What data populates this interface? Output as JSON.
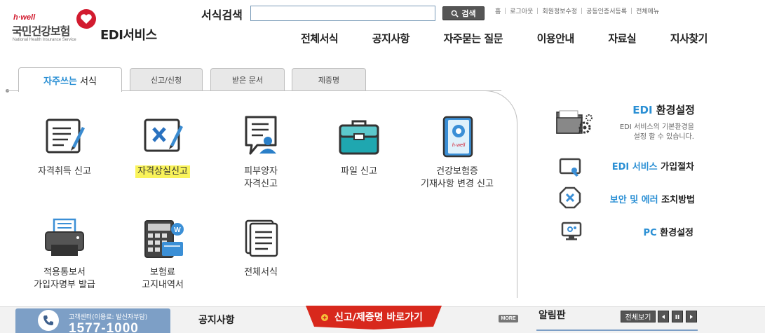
{
  "header": {
    "logo_top": "h·well",
    "logo_org": "국민건강보험",
    "logo_org_en": "National Health Insurance Service",
    "service_title": "EDI서비스",
    "search_label": "서식검색",
    "search_value": "",
    "search_button": "검색",
    "util_links": [
      "홈",
      "로그아웃",
      "회원정보수정",
      "공동인증서등록",
      "전체메뉴"
    ],
    "nav": [
      "전체서식",
      "공지사항",
      "자주묻는 질문",
      "이용안내",
      "자료실",
      "지사찾기"
    ]
  },
  "tabs": [
    {
      "highlight": "자주쓰는",
      "rest": " 서식",
      "active": true
    },
    {
      "label": "신고/신청",
      "active": false
    },
    {
      "label": "받은 문서",
      "active": false
    },
    {
      "label": "제증명",
      "active": false
    }
  ],
  "forms": [
    {
      "line1": "자격취득 신고",
      "line2": "",
      "icon": "document-pen-icon"
    },
    {
      "line1": "자격상실신고",
      "line2": "",
      "icon": "document-x-pen-icon",
      "highlighted": true
    },
    {
      "line1": "피부양자",
      "line2": "자격신고",
      "icon": "speech-person-icon"
    },
    {
      "line1": "파일 신고",
      "line2": "",
      "icon": "briefcase-icon"
    },
    {
      "line1": "건강보험증",
      "line2": "기재사항 변경 신고",
      "icon": "insurance-card-icon"
    },
    {
      "line1": "적용통보서",
      "line2": "가입자명부 발급",
      "icon": "printer-icon"
    },
    {
      "line1": "보험료",
      "line2": "고지내역서",
      "icon": "calculator-won-icon"
    },
    {
      "line1": "전체서식",
      "line2": "",
      "icon": "document-stack-icon"
    }
  ],
  "side": {
    "env_title_blue": "EDI",
    "env_title_rest": " 환경설정",
    "env_desc_line1": "EDI 서비스의 기본환경을",
    "env_desc_line2": "설정 할 수 있습니다.",
    "links": [
      {
        "blue": "EDI 서비스",
        "rest": " 가입절차"
      },
      {
        "blue": "보안 및 에러",
        "rest": " 조치방법"
      },
      {
        "blue": "PC",
        "rest": " 환경설정"
      }
    ]
  },
  "bottom": {
    "cs_label": "고객센터(이용료: 발신자부담)",
    "cs_number": "1577-1000",
    "notice_title": "공지사항",
    "shortcut": "신고/제증명 바로가기",
    "more": "MORE",
    "board_title": "알림판",
    "view_all": "전체보기"
  },
  "colors": {
    "accent_blue": "#2a8fd4",
    "brand_red": "#d21b2f",
    "highlight_yellow": "#f9f35a",
    "cs_box": "#7d9fc6"
  }
}
